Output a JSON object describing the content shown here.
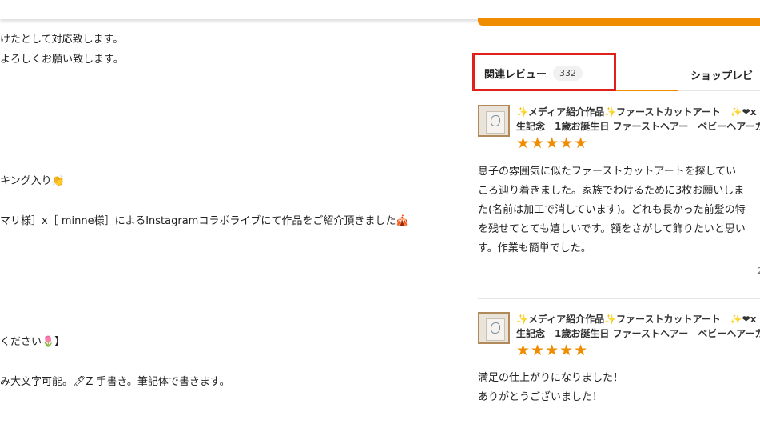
{
  "description": {
    "lines": [
      "けたとして対応致します。",
      "よろしくお願い致します。",
      "キング入り👏",
      "マリ様］x［ minne様］によるInstagramコラボライブにて作品をご紹介頂きました🎪",
      "ください🌷】",
      "み大文字可能。🖊Z 手書き。筆記体で書きます。"
    ]
  },
  "tabs": {
    "related_label": "関連レビュー",
    "related_count": "332",
    "shop_label": "ショップレビ"
  },
  "reviews": [
    {
      "product_line1": "✨メディア紹介作品✨ファーストカットアート　✨❤x",
      "product_line2": "生記念　1歳お誕生日 ファーストヘアー　ベビーヘアーカ",
      "stars": "★★★★★",
      "rating": 5,
      "text_lines": [
        "息子の雰囲気に似たファーストカットアートを探してい",
        "ころ辿り着きました。家族でわけるために3枚お願いしま",
        "た(名前は加工で消しています)。どれも長かった前髪の特",
        "を残せてとても嬉しいです。額をさがして飾りたいと思い",
        "す。作業も簡単でした。"
      ],
      "date_fragment": "2"
    },
    {
      "product_line1": "✨メディア紹介作品✨ファーストカットアート　✨❤x",
      "product_line2": "生記念　1歳お誕生日 ファーストヘアー　ベビーヘアーカ",
      "stars": "★★★★★",
      "rating": 5,
      "text_lines": [
        "満足の仕上がりになりました！",
        "ありがとうございました！"
      ]
    }
  ],
  "colors": {
    "accent": "#f08c00",
    "highlight": "#e0201a"
  }
}
